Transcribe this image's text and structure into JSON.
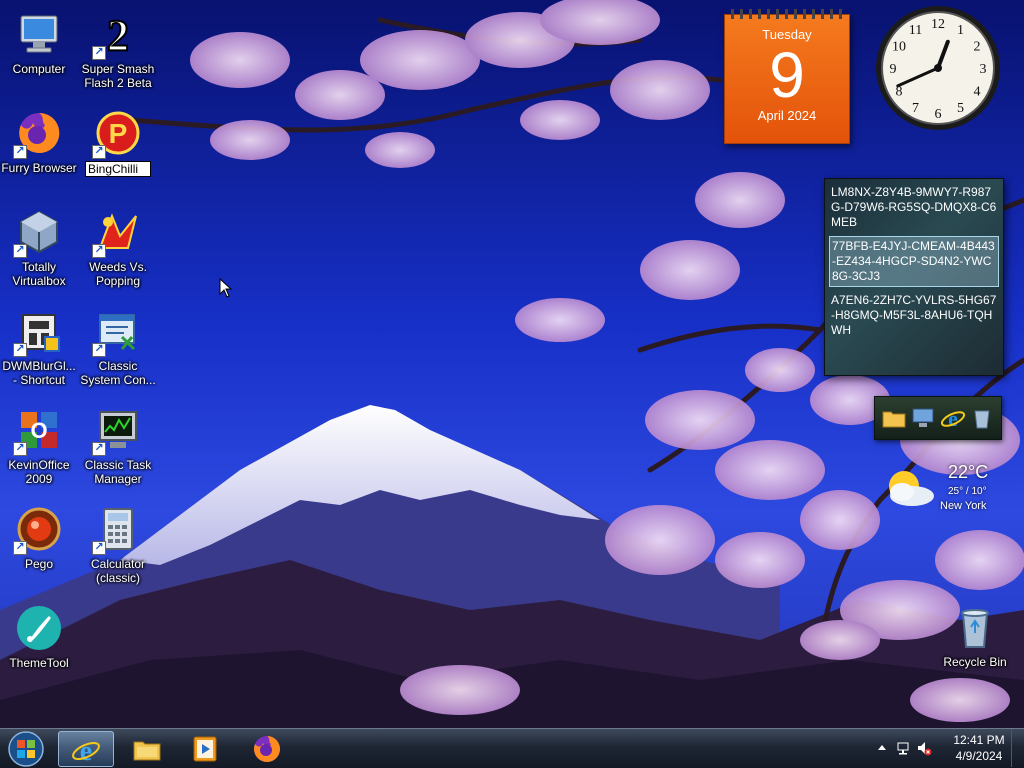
{
  "desktop": {
    "icons": [
      {
        "id": "computer",
        "label": "Computer",
        "icon": "computer-icon",
        "shortcut": false
      },
      {
        "id": "ssf2",
        "label": "Super Smash\nFlash 2 Beta",
        "icon": "ssf2-icon",
        "shortcut": true
      },
      {
        "id": "furry",
        "label": "Furry Browser",
        "icon": "firefox-icon",
        "shortcut": true
      },
      {
        "id": "bingchilli",
        "label": "BingChilli",
        "icon": "bingchilli-icon",
        "shortcut": true,
        "renaming": true
      },
      {
        "id": "virtualbox",
        "label": "Totally\nVirtualbox",
        "icon": "virtualbox-icon",
        "shortcut": true
      },
      {
        "id": "weeds",
        "label": "Weeds Vs.\nPopping",
        "icon": "weeds-icon",
        "shortcut": true
      },
      {
        "id": "dwmblur",
        "label": "DWMBlurGl...\n- Shortcut",
        "icon": "dwmblur-icon",
        "shortcut": true
      },
      {
        "id": "classicsys",
        "label": "Classic\nSystem Con...",
        "icon": "system-config-icon",
        "shortcut": true
      },
      {
        "id": "kevinoffice",
        "label": "KevinOffice\n2009",
        "icon": "office-icon",
        "shortcut": true
      },
      {
        "id": "classictask",
        "label": "Classic Task\nManager",
        "icon": "task-manager-icon",
        "shortcut": true
      },
      {
        "id": "pego",
        "label": "Pego",
        "icon": "pego-icon",
        "shortcut": true
      },
      {
        "id": "calculator",
        "label": "Calculator\n(classic)",
        "icon": "calculator-icon",
        "shortcut": true
      },
      {
        "id": "themetool",
        "label": "ThemeTool",
        "icon": "themetool-icon",
        "shortcut": false
      },
      {
        "id": "recycle",
        "label": "Recycle Bin",
        "icon": "recycle-bin-icon",
        "shortcut": false
      }
    ]
  },
  "gadgets": {
    "calendar": {
      "weekday": "Tuesday",
      "day": "9",
      "month_year": "April 2024"
    },
    "clock": {
      "hour": 12,
      "minute": 41,
      "numerals": [
        "12",
        "1",
        "2",
        "3",
        "4",
        "5",
        "6",
        "7",
        "8",
        "9",
        "10",
        "11"
      ]
    },
    "notes": [
      "LM8NX-Z8Y4B-9MWY7-R987G-D79W6-RG5SQ-DMQX8-C6MEB",
      "77BFB-E4JYJ-CMEAM-4B443-EZ434-4HGCP-SD4N2-YWC8G-3CJ3",
      "A7EN6-2ZH7C-YVLRS-5HG67-H8GMQ-M5F3L-8AHU6-TQHWH"
    ],
    "launcher": [
      "folder-icon",
      "network-icon",
      "internet-explorer-icon",
      "recycle-bin-icon"
    ],
    "weather": {
      "temp": "22°C",
      "range": "25° / 10°",
      "city": "New York",
      "icon": "partly-cloudy-icon"
    }
  },
  "taskbar": {
    "pinned": [
      {
        "id": "ie",
        "icon": "internet-explorer-icon",
        "active": true
      },
      {
        "id": "explorer",
        "icon": "folder-icon",
        "active": false
      },
      {
        "id": "media",
        "icon": "media-player-icon",
        "active": false
      },
      {
        "id": "firefox",
        "icon": "firefox-icon",
        "active": false
      }
    ],
    "tray": {
      "time": "12:41 PM",
      "date": "4/9/2024"
    }
  },
  "colors": {
    "calendar": "#e3530a",
    "taskbar": "#1e2634",
    "sky": "#0d1a8c"
  }
}
